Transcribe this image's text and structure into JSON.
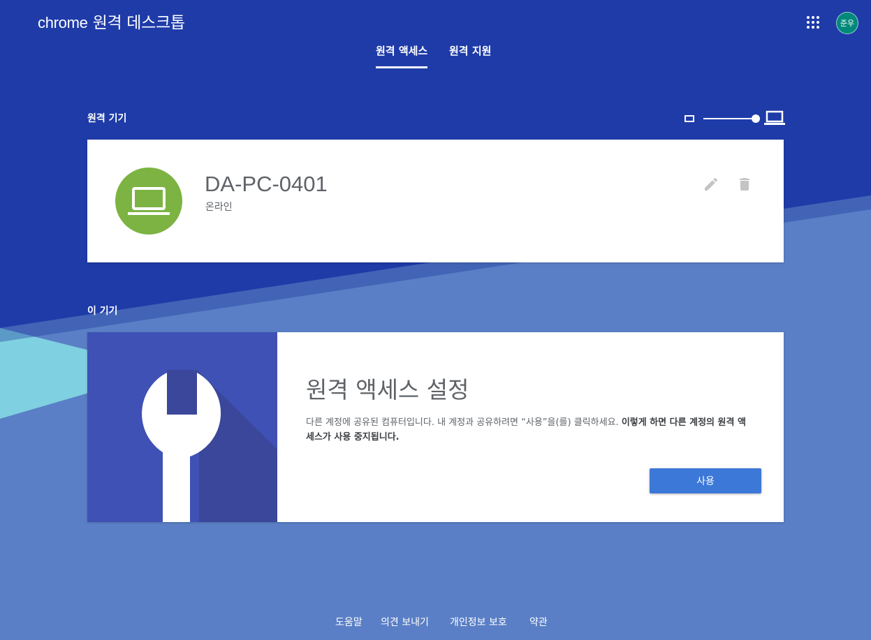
{
  "header": {
    "brand_prefix": "chrome",
    "brand_suffix": "원격 데스크톱",
    "avatar_text": "준우",
    "apps_icon": "apps-grid-icon"
  },
  "tabs": [
    {
      "label": "원격 액세스",
      "active": true
    },
    {
      "label": "원격 지원",
      "active": false
    }
  ],
  "remote_devices": {
    "title": "원격 기기",
    "size_toggle": {
      "small_icon": "small-display-icon",
      "large_icon": "laptop-icon"
    },
    "devices": [
      {
        "name": "DA-PC-0401",
        "status": "온라인",
        "icon": "laptop-icon",
        "edit_icon": "pencil-icon",
        "delete_icon": "trash-icon"
      }
    ]
  },
  "this_device": {
    "title": "이 기기",
    "card": {
      "icon": "wrench-icon",
      "heading": "원격 액세스 설정",
      "description": "다른 계정에 공유된 컴퓨터입니다. 내 계정과 공유하려면 “사용”을(를) 클릭하세요.",
      "description_bold": "이렇게 하면 다른 계정의 원격 액세스가 사용 중지됩니다.",
      "button_label": "사용"
    }
  },
  "footer": {
    "links": [
      "도움말",
      "의견 보내기",
      "개인정보 보호",
      "약관"
    ]
  },
  "colors": {
    "header_blue": "#1e3ba8",
    "device_green": "#7cb342",
    "wrench_panel": "#3f51b5",
    "button_blue": "#3c78d8"
  }
}
